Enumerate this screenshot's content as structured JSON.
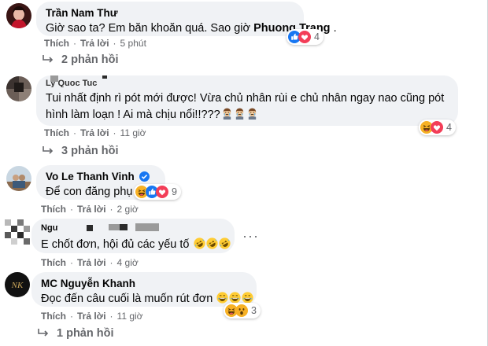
{
  "colors": {
    "bubble": "#f0f2f5",
    "meta": "#65676b",
    "link": "#1877f2"
  },
  "comments": [
    {
      "name": "Trần Nam Thư",
      "text_prefix": "Giờ sao ta? Em băn khoăn quá. Sao giờ ",
      "mention": "Phuong Trang",
      "text_suffix": " .",
      "like": "Thích",
      "reply": "Trả lời",
      "time": "5 phút",
      "reaction_icons": [
        "like-icon",
        "love-icon"
      ],
      "reaction_count": "4",
      "replies": "2 phản hồi"
    },
    {
      "name": "Ly Quoc Tuc",
      "line1": "Tui nhất định rì pót mới được! Vừa chủ nhân rùi e chủ nhân ngay nao cũng pót",
      "line2": "hình làm loạn ! Ai mà chịu nổi!!???",
      "line2_emojis": [
        "crying-face-icon",
        "crying-face-icon",
        "crying-face-icon"
      ],
      "like": "Thích",
      "reply": "Trả lời",
      "time": "11 giờ",
      "reaction_icons": [
        "haha-icon",
        "love-icon"
      ],
      "reaction_count": "4",
      "replies": "3 phản hồi"
    },
    {
      "name": "Vo Le Thanh Vinh",
      "verified": true,
      "text": "Để con đăng phụ",
      "like": "Thích",
      "reply": "Trả lời",
      "time": "2 giờ",
      "reaction_icons": [
        "haha-icon",
        "like-icon",
        "love-icon"
      ],
      "reaction_count": "9"
    },
    {
      "name": "Nguyen",
      "text": "E chốt đơn, hội đủ các yếu tố",
      "text_emojis": [
        "rofl-icon",
        "rofl-icon",
        "rofl-icon"
      ],
      "like": "Thích",
      "reply": "Trả lời",
      "time": "4 giờ",
      "more": "···"
    },
    {
      "name": "MC Nguyễn Khanh",
      "avatar_text": "NK",
      "text": "Đọc đến câu cuối là muốn rút đơn",
      "text_emojis": [
        "laughing-icon",
        "laughing-icon",
        "laughing-icon"
      ],
      "like": "Thích",
      "reply": "Trả lời",
      "time": "11 giờ",
      "reaction_icons": [
        "haha-icon",
        "wow-icon"
      ],
      "reaction_count": "3",
      "replies": "1 phản hồi"
    }
  ]
}
